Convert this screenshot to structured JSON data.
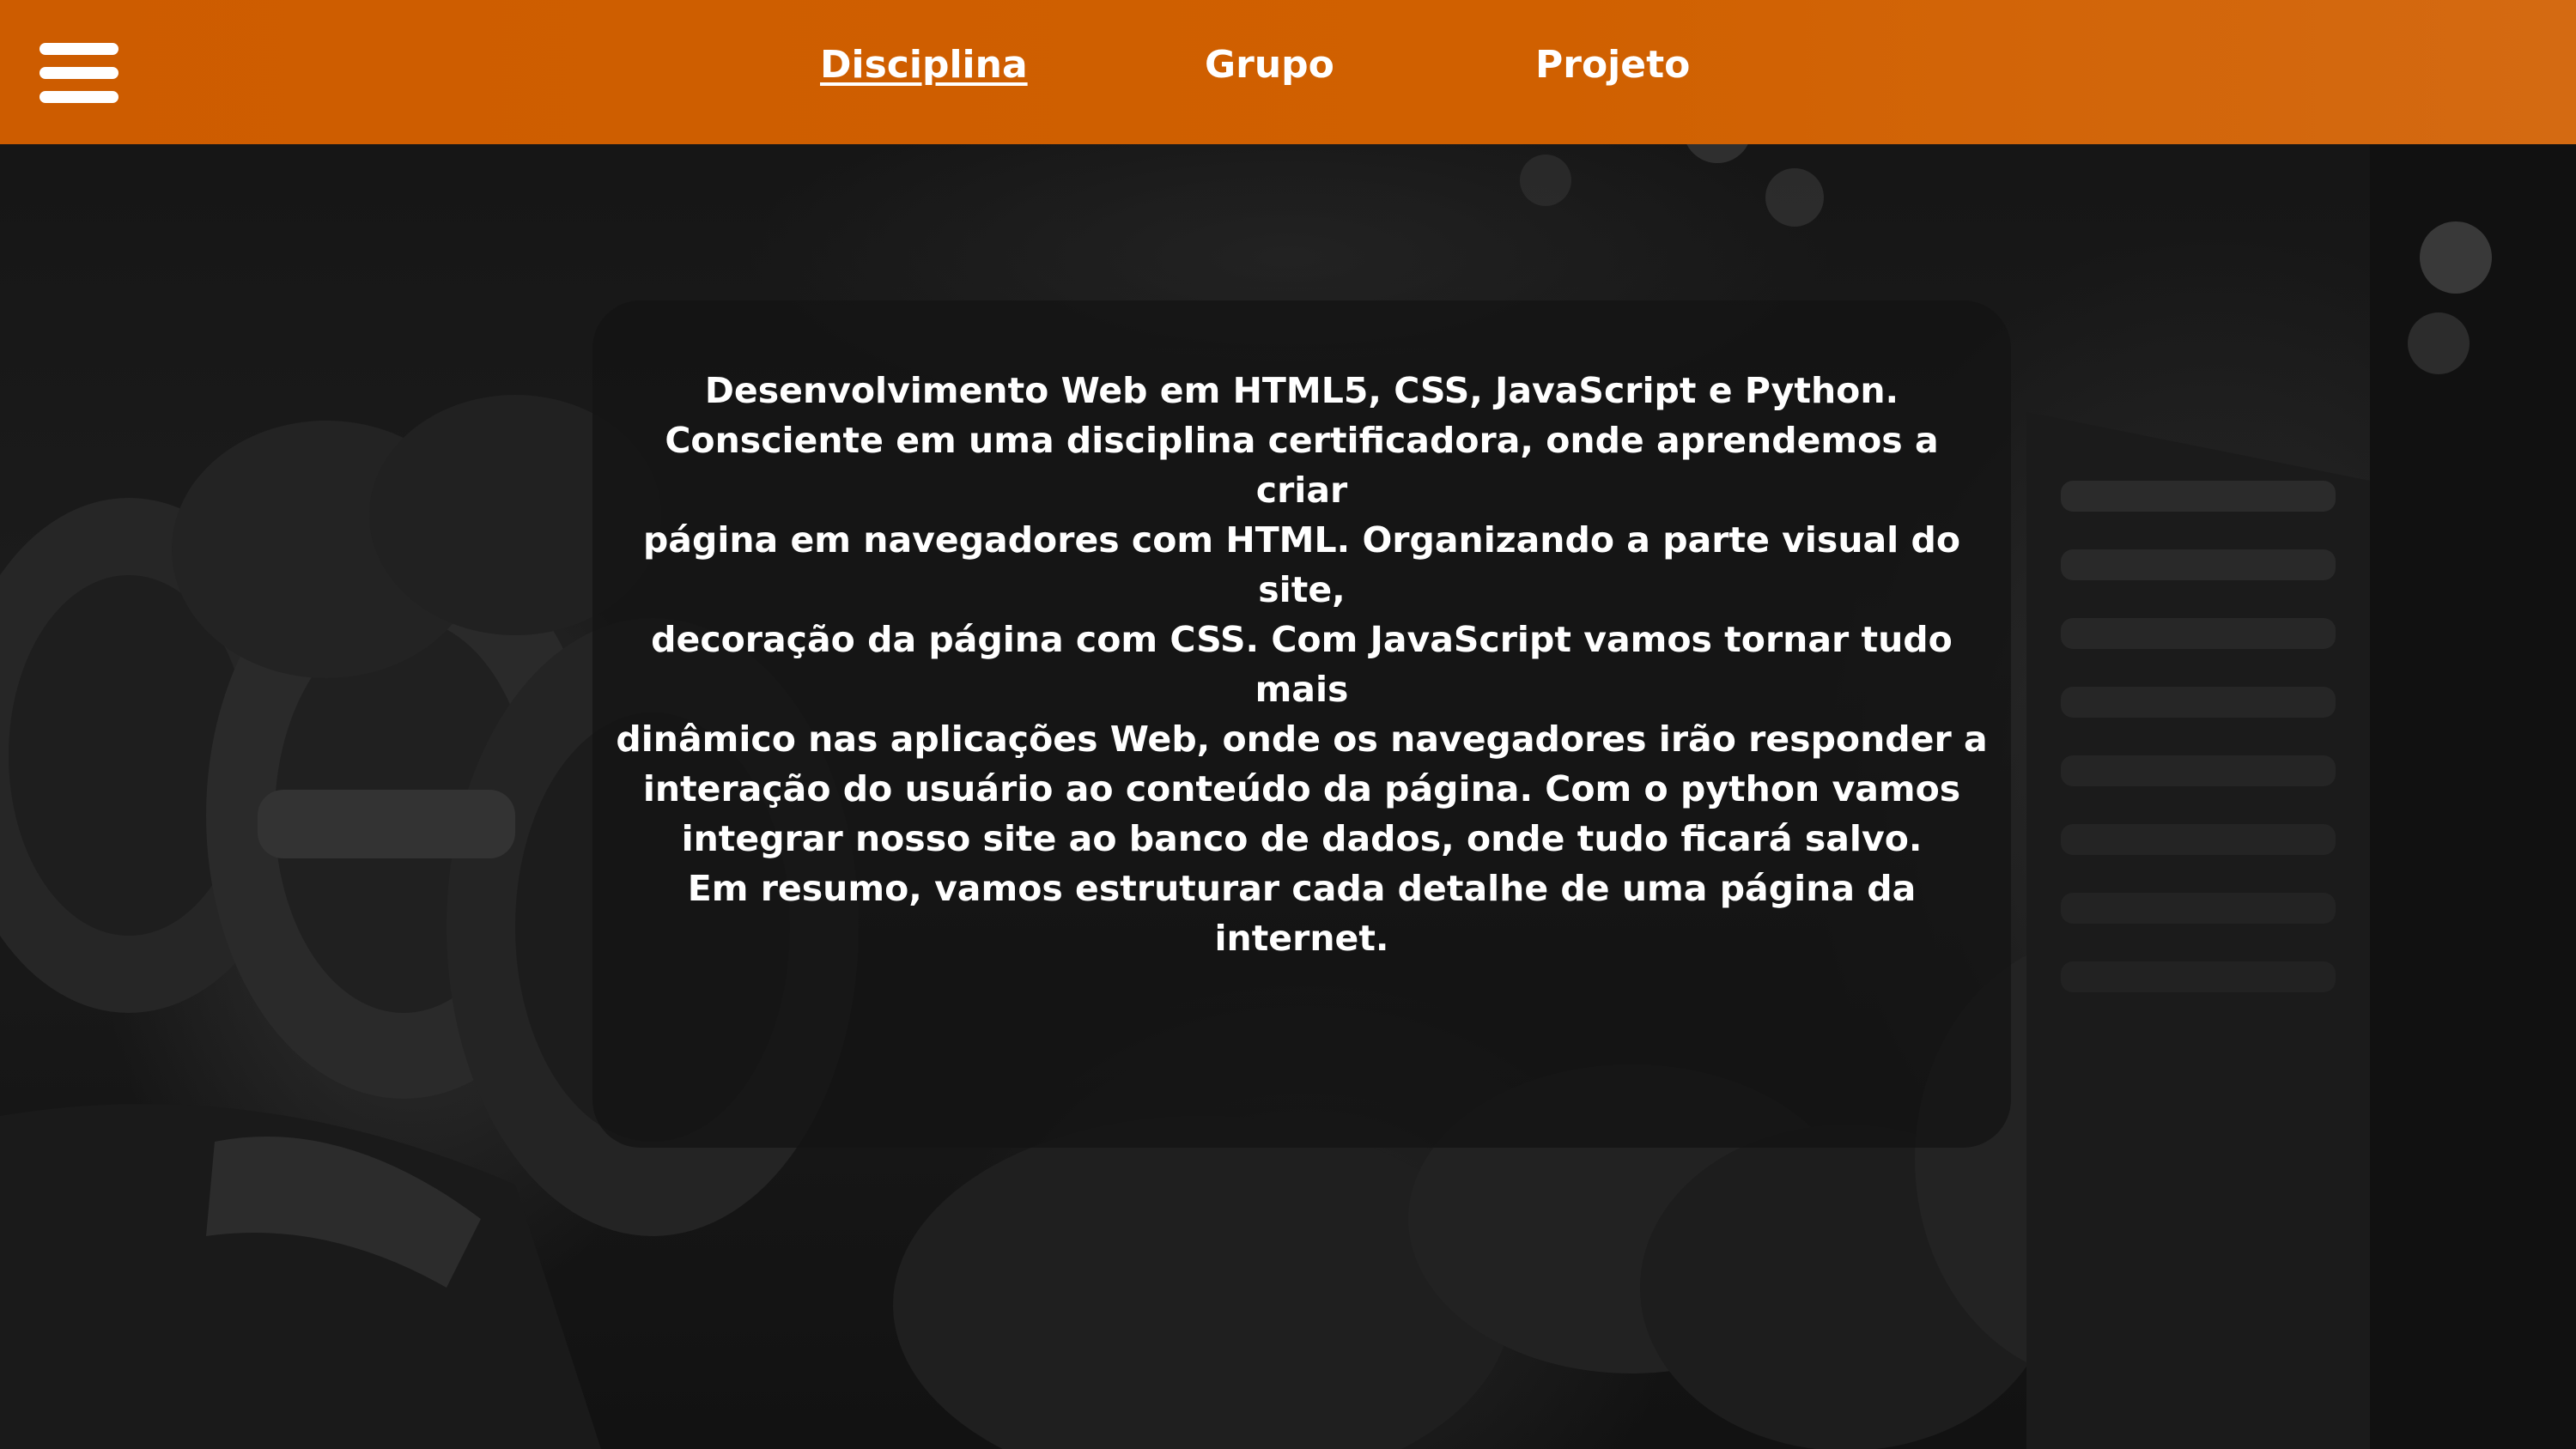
{
  "navbar": {
    "menu_icon": "hamburger-menu-icon",
    "background_color": "#cf5f00",
    "links": [
      {
        "label": "Disciplina",
        "active": true
      },
      {
        "label": "Grupo",
        "active": false
      },
      {
        "label": "Projeto",
        "active": false
      }
    ]
  },
  "card": {
    "lines": [
      "Desenvolvimento Web em HTML5, CSS, JavaScript e Python.",
      "Consciente em uma disciplina certificadora, onde aprendemos a criar",
      "página em navegadores com HTML. Organizando a parte visual do site,",
      "decoração da página com CSS. Com JavaScript vamos tornar tudo mais",
      "dinâmico nas aplicações Web, onde os navegadores irão responder a",
      "interação do usuário ao conteúdo da página.  Com o python vamos",
      "integrar nosso site ao banco de dados, onde tudo ficará salvo.",
      "Em resumo, vamos estruturar cada detalhe de uma página da internet."
    ]
  },
  "background": {
    "image_subject": "gym dumbbells rack (dark, desaturated)"
  }
}
